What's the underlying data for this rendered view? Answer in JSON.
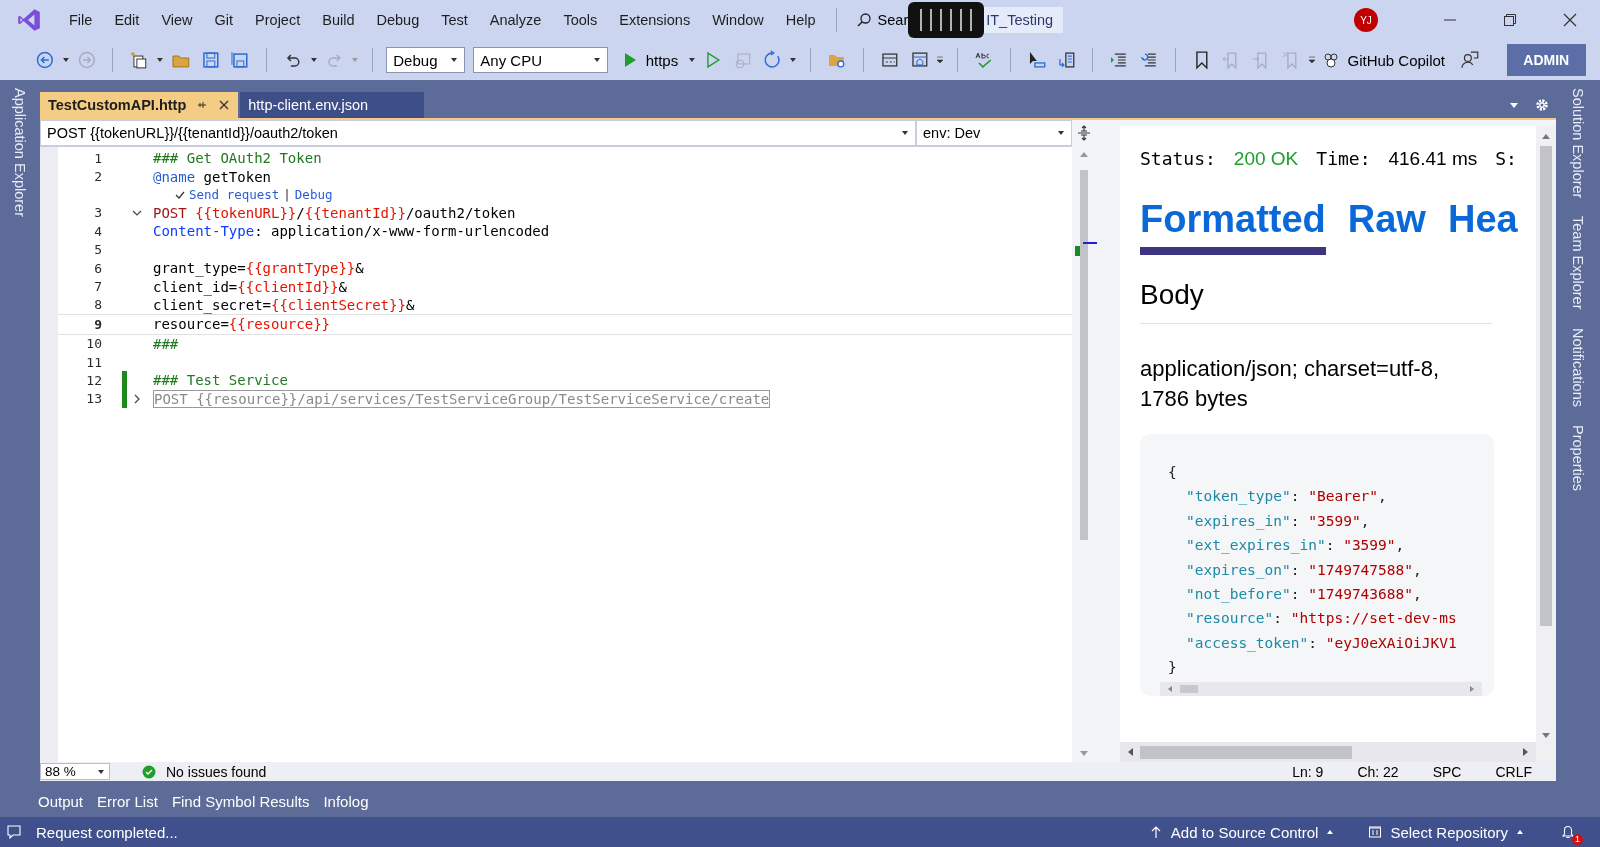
{
  "menu": [
    "File",
    "Edit",
    "View",
    "Git",
    "Project",
    "Build",
    "Debug",
    "Test",
    "Analyze",
    "Tools",
    "Extensions",
    "Window",
    "Help"
  ],
  "search": {
    "label": "Sear"
  },
  "solution": "IT_Testing",
  "account": {
    "initials": "YJ"
  },
  "toolbar": {
    "configuration": "Debug",
    "platform": "Any CPU",
    "run_target": "https",
    "copilot": "GitHub Copilot",
    "admin": "ADMIN"
  },
  "side_left": [
    "Application Explorer"
  ],
  "side_right": [
    "Solution Explorer",
    "Team Explorer",
    "Notifications",
    "Properties"
  ],
  "tabs": [
    {
      "label": "TestCustomAPI.http",
      "selected": true
    },
    {
      "label": "http-client.env.json",
      "selected": false
    }
  ],
  "navbar": {
    "request": "POST {{tokenURL}}/{{tenantId}}/oauth2/token",
    "environment": "env: Dev"
  },
  "editor": {
    "lines": [
      {
        "num": "1",
        "current": false,
        "changed": false,
        "parts": [
          {
            "kind": "comment",
            "text": "### Get OAuth2 Token"
          }
        ]
      },
      {
        "num": "2",
        "current": false,
        "changed": false,
        "parts": [
          {
            "kind": "directive",
            "text": "@name"
          },
          {
            "kind": "plain",
            "text": " getToken"
          }
        ],
        "codelens": {
          "items": [
            "Send request",
            "Debug"
          ],
          "separator": "|"
        }
      },
      {
        "num": "3",
        "current": false,
        "changed": false,
        "expanded": true,
        "parts": [
          {
            "kind": "method",
            "text": "POST "
          },
          {
            "kind": "var",
            "text": "{{tokenURL}}"
          },
          {
            "kind": "plain",
            "text": "/"
          },
          {
            "kind": "var",
            "text": "{{tenantId}}"
          },
          {
            "kind": "plain",
            "text": "/oauth2/token"
          }
        ]
      },
      {
        "num": "4",
        "current": false,
        "changed": false,
        "parts": [
          {
            "kind": "header",
            "text": "Content-Type"
          },
          {
            "kind": "plain",
            "text": ": application/x-www-form-urlencoded"
          }
        ]
      },
      {
        "num": "5",
        "current": false,
        "changed": false
      },
      {
        "num": "6",
        "current": false,
        "changed": false,
        "parts": [
          {
            "kind": "plain",
            "text": "grant_type="
          },
          {
            "kind": "var",
            "text": "{{grantType}}"
          },
          {
            "kind": "plain",
            "text": "&"
          }
        ]
      },
      {
        "num": "7",
        "current": false,
        "changed": false,
        "parts": [
          {
            "kind": "plain",
            "text": "client_id="
          },
          {
            "kind": "var",
            "text": "{{clientId}}"
          },
          {
            "kind": "plain",
            "text": "&"
          }
        ]
      },
      {
        "num": "8",
        "current": false,
        "changed": false,
        "parts": [
          {
            "kind": "plain",
            "text": "client_secret="
          },
          {
            "kind": "var",
            "text": "{{clientSecret}}"
          },
          {
            "kind": "plain",
            "text": "&"
          }
        ]
      },
      {
        "num": "9",
        "current": true,
        "changed": false,
        "parts": [
          {
            "kind": "plain",
            "text": "resource="
          },
          {
            "kind": "var",
            "text": "{{resource}}"
          }
        ]
      },
      {
        "num": "10",
        "current": false,
        "changed": false,
        "parts": [
          {
            "kind": "comment",
            "text": "###"
          }
        ]
      },
      {
        "num": "11",
        "current": false,
        "changed": false
      },
      {
        "num": "12",
        "current": false,
        "changed": true,
        "parts": [
          {
            "kind": "comment",
            "text": "### Test Service"
          }
        ]
      },
      {
        "num": "13",
        "current": false,
        "changed": true,
        "expanded": false,
        "parts": [
          {
            "kind": "plain",
            "text": "POST {{resource}}/api/services/TestServiceGroup/TestServiceService/create"
          }
        ]
      }
    ],
    "zoom": "88 %",
    "issues": "No issues found",
    "position": [
      "Ln: 9",
      "Ch: 22",
      "SPC",
      "CRLF"
    ]
  },
  "response": {
    "status_label": "Status:",
    "status": "200 OK",
    "time_label": "Time:",
    "time": "416.41 ms",
    "more": "S:",
    "views": [
      {
        "label": "Formatted",
        "selected": true
      },
      {
        "label": "Raw",
        "selected": false
      },
      {
        "label": "Hea",
        "selected": false
      }
    ],
    "body_title": "Body",
    "content_type": "application/json; charset=utf-8, 1786 bytes",
    "json": [
      [
        {
          "kind": "punct",
          "text": "{"
        }
      ],
      [
        {
          "kind": "key",
          "text": "\"token_type\""
        },
        {
          "kind": "punct",
          "text": ": "
        },
        {
          "kind": "value",
          "text": "\"Bearer\""
        },
        {
          "kind": "punct",
          "text": ","
        }
      ],
      [
        {
          "kind": "key",
          "text": "\"expires_in\""
        },
        {
          "kind": "punct",
          "text": ": "
        },
        {
          "kind": "value",
          "text": "\"3599\""
        },
        {
          "kind": "punct",
          "text": ","
        }
      ],
      [
        {
          "kind": "key",
          "text": "\"ext_expires_in\""
        },
        {
          "kind": "punct",
          "text": ": "
        },
        {
          "kind": "value",
          "text": "\"3599\""
        },
        {
          "kind": "punct",
          "text": ","
        }
      ],
      [
        {
          "kind": "key",
          "text": "\"expires_on\""
        },
        {
          "kind": "punct",
          "text": ": "
        },
        {
          "kind": "value",
          "text": "\"1749747588\""
        },
        {
          "kind": "punct",
          "text": ","
        }
      ],
      [
        {
          "kind": "key",
          "text": "\"not_before\""
        },
        {
          "kind": "punct",
          "text": ": "
        },
        {
          "kind": "value",
          "text": "\"1749743688\""
        },
        {
          "kind": "punct",
          "text": ","
        }
      ],
      [
        {
          "kind": "key",
          "text": "\"resource\""
        },
        {
          "kind": "punct",
          "text": ": "
        },
        {
          "kind": "value",
          "text": "\"https://set-dev-ms"
        }
      ],
      [
        {
          "kind": "key",
          "text": "\"access_token\""
        },
        {
          "kind": "punct",
          "text": ": "
        },
        {
          "kind": "value",
          "text": "\"eyJ0eXAiOiJKV1"
        }
      ],
      [
        {
          "kind": "punct",
          "text": "}"
        }
      ]
    ]
  },
  "tool_tabs": [
    "Output",
    "Error List",
    "Find Symbol Results",
    "Infolog"
  ],
  "status_bar": {
    "message": "Request completed...",
    "source_control": "Add to Source Control",
    "repository": "Select Repository",
    "notifications": "1"
  }
}
